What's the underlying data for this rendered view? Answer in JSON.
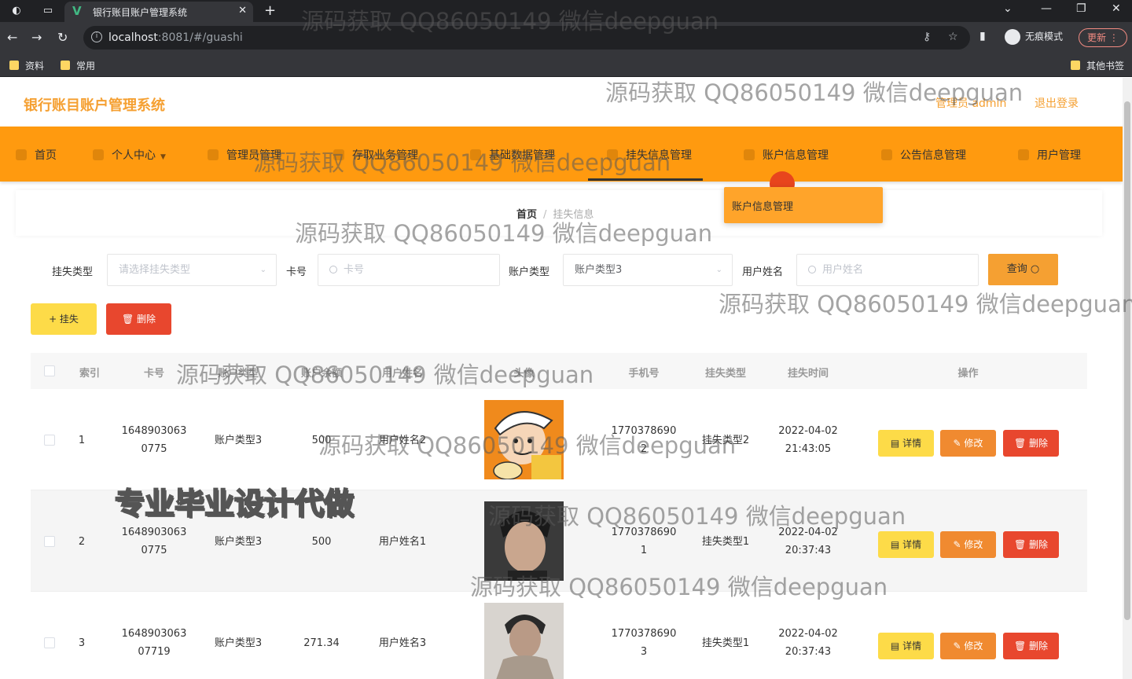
{
  "browser": {
    "tab_title": "银行账目账户管理系统",
    "tab_close": "✕",
    "new_tab": "+",
    "url_host": "localhost",
    "url_path": ":8081/#/guashi",
    "incognito_label": "无痕模式",
    "update_label": "更新",
    "bookmarks": [
      "资料",
      "常用"
    ],
    "other_bookmarks": "其他书签"
  },
  "header": {
    "system_title": "银行账目账户管理系统",
    "admin_label": "管理员 admin",
    "logout_label": "退出登录"
  },
  "nav": {
    "items": [
      {
        "label": "首页",
        "icon": "home-icon"
      },
      {
        "label": "个人中心",
        "icon": "user-icon"
      },
      {
        "label": "管理员管理",
        "icon": "admin-icon"
      },
      {
        "label": "存取业务管理",
        "icon": "deposit-icon"
      },
      {
        "label": "基础数据管理",
        "icon": "database-icon"
      },
      {
        "label": "挂失信息管理",
        "icon": "report-loss-icon"
      },
      {
        "label": "账户信息管理",
        "icon": "account-icon"
      },
      {
        "label": "公告信息管理",
        "icon": "notice-icon"
      },
      {
        "label": "用户管理",
        "icon": "users-icon"
      }
    ],
    "dropdown_item": "账户信息管理"
  },
  "breadcrumb": {
    "home": "首页",
    "separator": "/",
    "current": "挂失信息"
  },
  "filters": {
    "loss_type_label": "挂失类型",
    "loss_type_placeholder": "请选择挂失类型",
    "card_label": "卡号",
    "card_placeholder": "卡号",
    "account_type_label": "账户类型",
    "account_type_value": "账户类型3",
    "user_name_label": "用户姓名",
    "user_name_placeholder": "用户姓名",
    "query_label": "查询"
  },
  "toolbar": {
    "add_label": "+ 挂失",
    "delete_label": "删除"
  },
  "table": {
    "headers": [
      "索引",
      "卡号",
      "账户类型",
      "账户余额",
      "用户姓名",
      "头像",
      "手机号",
      "挂失类型",
      "挂失时间",
      "操作"
    ],
    "rows": [
      {
        "index": "1",
        "card_1": "1648903063",
        "card_2": "0775",
        "account_type": "账户类型3",
        "balance": "500",
        "user_name": "用户姓名2",
        "phone_1": "1770378690",
        "phone_2": "2",
        "loss_type": "挂失类型2",
        "date": "2022-04-02",
        "time": "21:43:05"
      },
      {
        "index": "2",
        "card_1": "1648903063",
        "card_2": "0775",
        "account_type": "账户类型3",
        "balance": "500",
        "user_name": "用户姓名1",
        "phone_1": "1770378690",
        "phone_2": "1",
        "loss_type": "挂失类型1",
        "date": "2022-04-02",
        "time": "20:37:43"
      },
      {
        "index": "3",
        "card_1": "1648903063",
        "card_2": "07719",
        "account_type": "账户类型3",
        "balance": "271.34",
        "user_name": "用户姓名3",
        "phone_1": "1770378690",
        "phone_2": "3",
        "loss_type": "挂失类型1",
        "date": "2022-04-02",
        "time": "20:37:43"
      }
    ],
    "actions": {
      "detail": "详情",
      "edit": "修改",
      "remove": "删除"
    }
  },
  "overlays": {
    "watermark": "源码获取 QQ86050149 微信deepguan",
    "promo": "专业毕业设计代做"
  },
  "colors": {
    "navbar": "#ff9a0f",
    "accent": "#f5a032",
    "detail_button": "#fddb48",
    "edit_button": "#f08a30",
    "delete_button": "#e8472e"
  }
}
